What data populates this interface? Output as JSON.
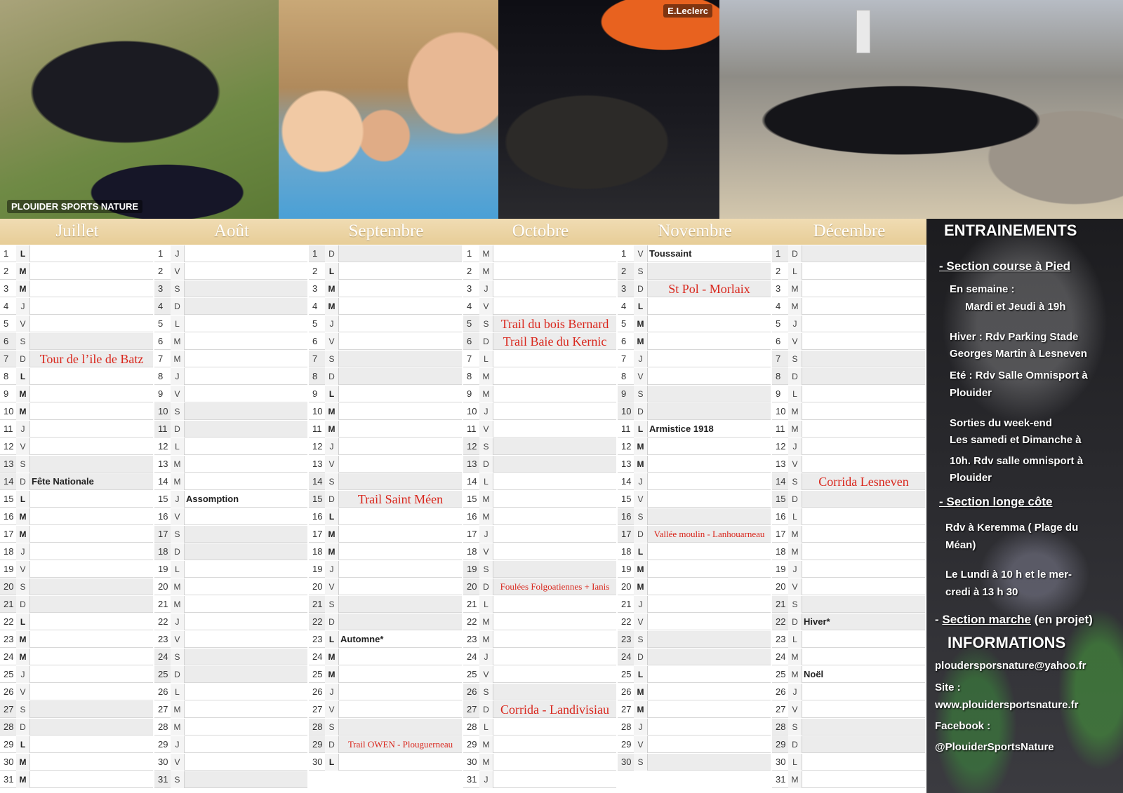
{
  "photos": [
    "PLOUIDER SPORTS NATURE",
    "",
    "E.Leclerc",
    ""
  ],
  "months": [
    {
      "name": "Juillet",
      "days": [
        {
          "n": "1",
          "d": "L"
        },
        {
          "n": "2",
          "d": "M"
        },
        {
          "n": "3",
          "d": "M"
        },
        {
          "n": "4",
          "d": "J"
        },
        {
          "n": "5",
          "d": "V"
        },
        {
          "n": "6",
          "d": "S"
        },
        {
          "n": "7",
          "d": "D",
          "e": "Tour de l’ile de Batz",
          "red": true
        },
        {
          "n": "8",
          "d": "L"
        },
        {
          "n": "9",
          "d": "M"
        },
        {
          "n": "10",
          "d": "M"
        },
        {
          "n": "11",
          "d": "J"
        },
        {
          "n": "12",
          "d": "V"
        },
        {
          "n": "13",
          "d": "S"
        },
        {
          "n": "14",
          "d": "D",
          "e": "Fête Nationale"
        },
        {
          "n": "15",
          "d": "L"
        },
        {
          "n": "16",
          "d": "M"
        },
        {
          "n": "17",
          "d": "M"
        },
        {
          "n": "18",
          "d": "J"
        },
        {
          "n": "19",
          "d": "V"
        },
        {
          "n": "20",
          "d": "S"
        },
        {
          "n": "21",
          "d": "D"
        },
        {
          "n": "22",
          "d": "L"
        },
        {
          "n": "23",
          "d": "M"
        },
        {
          "n": "24",
          "d": "M"
        },
        {
          "n": "25",
          "d": "J"
        },
        {
          "n": "26",
          "d": "V"
        },
        {
          "n": "27",
          "d": "S"
        },
        {
          "n": "28",
          "d": "D"
        },
        {
          "n": "29",
          "d": "L"
        },
        {
          "n": "30",
          "d": "M"
        },
        {
          "n": "31",
          "d": "M"
        }
      ]
    },
    {
      "name": "Août",
      "days": [
        {
          "n": "1",
          "d": "J"
        },
        {
          "n": "2",
          "d": "V"
        },
        {
          "n": "3",
          "d": "S"
        },
        {
          "n": "4",
          "d": "D"
        },
        {
          "n": "5",
          "d": "L"
        },
        {
          "n": "6",
          "d": "M"
        },
        {
          "n": "7",
          "d": "M"
        },
        {
          "n": "8",
          "d": "J"
        },
        {
          "n": "9",
          "d": "V"
        },
        {
          "n": "10",
          "d": "S"
        },
        {
          "n": "11",
          "d": "D"
        },
        {
          "n": "12",
          "d": "L"
        },
        {
          "n": "13",
          "d": "M"
        },
        {
          "n": "14",
          "d": "M"
        },
        {
          "n": "15",
          "d": "J",
          "e": "Assomption"
        },
        {
          "n": "16",
          "d": "V"
        },
        {
          "n": "17",
          "d": "S"
        },
        {
          "n": "18",
          "d": "D"
        },
        {
          "n": "19",
          "d": "L"
        },
        {
          "n": "20",
          "d": "M"
        },
        {
          "n": "21",
          "d": "M"
        },
        {
          "n": "22",
          "d": "J"
        },
        {
          "n": "23",
          "d": "V"
        },
        {
          "n": "24",
          "d": "S"
        },
        {
          "n": "25",
          "d": "D"
        },
        {
          "n": "26",
          "d": "L"
        },
        {
          "n": "27",
          "d": "M"
        },
        {
          "n": "28",
          "d": "M"
        },
        {
          "n": "29",
          "d": "J"
        },
        {
          "n": "30",
          "d": "V"
        },
        {
          "n": "31",
          "d": "S"
        }
      ]
    },
    {
      "name": "Septembre",
      "days": [
        {
          "n": "1",
          "d": "D"
        },
        {
          "n": "2",
          "d": "L"
        },
        {
          "n": "3",
          "d": "M"
        },
        {
          "n": "4",
          "d": "M"
        },
        {
          "n": "5",
          "d": "J"
        },
        {
          "n": "6",
          "d": "V"
        },
        {
          "n": "7",
          "d": "S"
        },
        {
          "n": "8",
          "d": "D"
        },
        {
          "n": "9",
          "d": "L"
        },
        {
          "n": "10",
          "d": "M"
        },
        {
          "n": "11",
          "d": "M"
        },
        {
          "n": "12",
          "d": "J"
        },
        {
          "n": "13",
          "d": "V"
        },
        {
          "n": "14",
          "d": "S"
        },
        {
          "n": "15",
          "d": "D",
          "e": "Trail Saint Méen",
          "red": true
        },
        {
          "n": "16",
          "d": "L"
        },
        {
          "n": "17",
          "d": "M"
        },
        {
          "n": "18",
          "d": "M"
        },
        {
          "n": "19",
          "d": "J"
        },
        {
          "n": "20",
          "d": "V"
        },
        {
          "n": "21",
          "d": "S"
        },
        {
          "n": "22",
          "d": "D"
        },
        {
          "n": "23",
          "d": "L",
          "e": "Automne*"
        },
        {
          "n": "24",
          "d": "M"
        },
        {
          "n": "25",
          "d": "M"
        },
        {
          "n": "26",
          "d": "J"
        },
        {
          "n": "27",
          "d": "V"
        },
        {
          "n": "28",
          "d": "S"
        },
        {
          "n": "29",
          "d": "D",
          "e": "Trail OWEN - Plouguerneau",
          "red": true,
          "small": true
        },
        {
          "n": "30",
          "d": "L"
        }
      ]
    },
    {
      "name": "Octobre",
      "days": [
        {
          "n": "1",
          "d": "M"
        },
        {
          "n": "2",
          "d": "M"
        },
        {
          "n": "3",
          "d": "J"
        },
        {
          "n": "4",
          "d": "V"
        },
        {
          "n": "5",
          "d": "S",
          "e": "Trail du bois Bernard",
          "red": true
        },
        {
          "n": "6",
          "d": "D",
          "e": "Trail Baie du Kernic",
          "red": true
        },
        {
          "n": "7",
          "d": "L"
        },
        {
          "n": "8",
          "d": "M"
        },
        {
          "n": "9",
          "d": "M"
        },
        {
          "n": "10",
          "d": "J"
        },
        {
          "n": "11",
          "d": "V"
        },
        {
          "n": "12",
          "d": "S"
        },
        {
          "n": "13",
          "d": "D"
        },
        {
          "n": "14",
          "d": "L"
        },
        {
          "n": "15",
          "d": "M"
        },
        {
          "n": "16",
          "d": "M"
        },
        {
          "n": "17",
          "d": "J"
        },
        {
          "n": "18",
          "d": "V"
        },
        {
          "n": "19",
          "d": "S"
        },
        {
          "n": "20",
          "d": "D",
          "e": "Foulées Folgoatiennes + Ianis",
          "red": true,
          "small": true
        },
        {
          "n": "21",
          "d": "L"
        },
        {
          "n": "22",
          "d": "M"
        },
        {
          "n": "23",
          "d": "M"
        },
        {
          "n": "24",
          "d": "J"
        },
        {
          "n": "25",
          "d": "V"
        },
        {
          "n": "26",
          "d": "S"
        },
        {
          "n": "27",
          "d": "D",
          "e": "Corrida - Landivisiau",
          "red": true
        },
        {
          "n": "28",
          "d": "L"
        },
        {
          "n": "29",
          "d": "M"
        },
        {
          "n": "30",
          "d": "M"
        },
        {
          "n": "31",
          "d": "J"
        }
      ]
    },
    {
      "name": "Novembre",
      "days": [
        {
          "n": "1",
          "d": "V",
          "e": "Toussaint"
        },
        {
          "n": "2",
          "d": "S"
        },
        {
          "n": "3",
          "d": "D",
          "e": "St Pol - Morlaix",
          "red": true
        },
        {
          "n": "4",
          "d": "L"
        },
        {
          "n": "5",
          "d": "M"
        },
        {
          "n": "6",
          "d": "M"
        },
        {
          "n": "7",
          "d": "J"
        },
        {
          "n": "8",
          "d": "V"
        },
        {
          "n": "9",
          "d": "S"
        },
        {
          "n": "10",
          "d": "D"
        },
        {
          "n": "11",
          "d": "L",
          "e": "Armistice 1918"
        },
        {
          "n": "12",
          "d": "M"
        },
        {
          "n": "13",
          "d": "M"
        },
        {
          "n": "14",
          "d": "J"
        },
        {
          "n": "15",
          "d": "V"
        },
        {
          "n": "16",
          "d": "S"
        },
        {
          "n": "17",
          "d": "D",
          "e": "Vallée moulin - Lanhouarneau",
          "red": true,
          "small": true
        },
        {
          "n": "18",
          "d": "L"
        },
        {
          "n": "19",
          "d": "M"
        },
        {
          "n": "20",
          "d": "M"
        },
        {
          "n": "21",
          "d": "J"
        },
        {
          "n": "22",
          "d": "V"
        },
        {
          "n": "23",
          "d": "S"
        },
        {
          "n": "24",
          "d": "D"
        },
        {
          "n": "25",
          "d": "L"
        },
        {
          "n": "26",
          "d": "M"
        },
        {
          "n": "27",
          "d": "M"
        },
        {
          "n": "28",
          "d": "J"
        },
        {
          "n": "29",
          "d": "V"
        },
        {
          "n": "30",
          "d": "S"
        }
      ]
    },
    {
      "name": "Décembre",
      "days": [
        {
          "n": "1",
          "d": "D"
        },
        {
          "n": "2",
          "d": "L"
        },
        {
          "n": "3",
          "d": "M"
        },
        {
          "n": "4",
          "d": "M"
        },
        {
          "n": "5",
          "d": "J"
        },
        {
          "n": "6",
          "d": "V"
        },
        {
          "n": "7",
          "d": "S"
        },
        {
          "n": "8",
          "d": "D"
        },
        {
          "n": "9",
          "d": "L"
        },
        {
          "n": "10",
          "d": "M"
        },
        {
          "n": "11",
          "d": "M"
        },
        {
          "n": "12",
          "d": "J"
        },
        {
          "n": "13",
          "d": "V"
        },
        {
          "n": "14",
          "d": "S",
          "e": "Corrida Lesneven",
          "red": true
        },
        {
          "n": "15",
          "d": "D"
        },
        {
          "n": "16",
          "d": "L"
        },
        {
          "n": "17",
          "d": "M"
        },
        {
          "n": "18",
          "d": "M"
        },
        {
          "n": "19",
          "d": "J"
        },
        {
          "n": "20",
          "d": "V"
        },
        {
          "n": "21",
          "d": "S"
        },
        {
          "n": "22",
          "d": "D",
          "e": "Hiver*"
        },
        {
          "n": "23",
          "d": "L"
        },
        {
          "n": "24",
          "d": "M"
        },
        {
          "n": "25",
          "d": "M",
          "e": "Noël"
        },
        {
          "n": "26",
          "d": "J"
        },
        {
          "n": "27",
          "d": "V"
        },
        {
          "n": "28",
          "d": "S"
        },
        {
          "n": "29",
          "d": "D"
        },
        {
          "n": "30",
          "d": "L"
        },
        {
          "n": "31",
          "d": "M"
        }
      ]
    }
  ],
  "panel": {
    "title": "ENTRAINEMENTS",
    "section1": "- Section course à Pied",
    "s1_l1": "En semaine :",
    "s1_l2": "Mardi et Jeudi à 19h",
    "s1_l3": "Hiver : Rdv Parking Stade",
    "s1_l4": "Georges Martin à Lesneven",
    "s1_l5": "Eté : Rdv Salle Omnisport à",
    "s1_l6": "Plouider",
    "s1_l7": "Sorties du week-end",
    "s1_l8": "Les samedi et Dimanche à",
    "s1_l9": "10h. Rdv salle omnisport à",
    "s1_l10": "Plouider",
    "section2": "- Section longe côte",
    "s2_l1": "Rdv à Keremma ( Plage du",
    "s2_l2": "Méan)",
    "s2_l3": "Le Lundi à 10 h et le mer-",
    "s2_l4": "credi à 13 h 30",
    "section3_prefix": "- ",
    "section3": "Section marche",
    "section3_suffix": " (en projet)",
    "info_title": "INFORMATIONS",
    "email": "ploudersporsnature@yahoo.fr",
    "site_label": "Site :",
    "site_url": "www.plouidersportsnature.fr",
    "facebook_label": "Facebook :",
    "facebook_handle": "@PlouiderSportsNature"
  }
}
